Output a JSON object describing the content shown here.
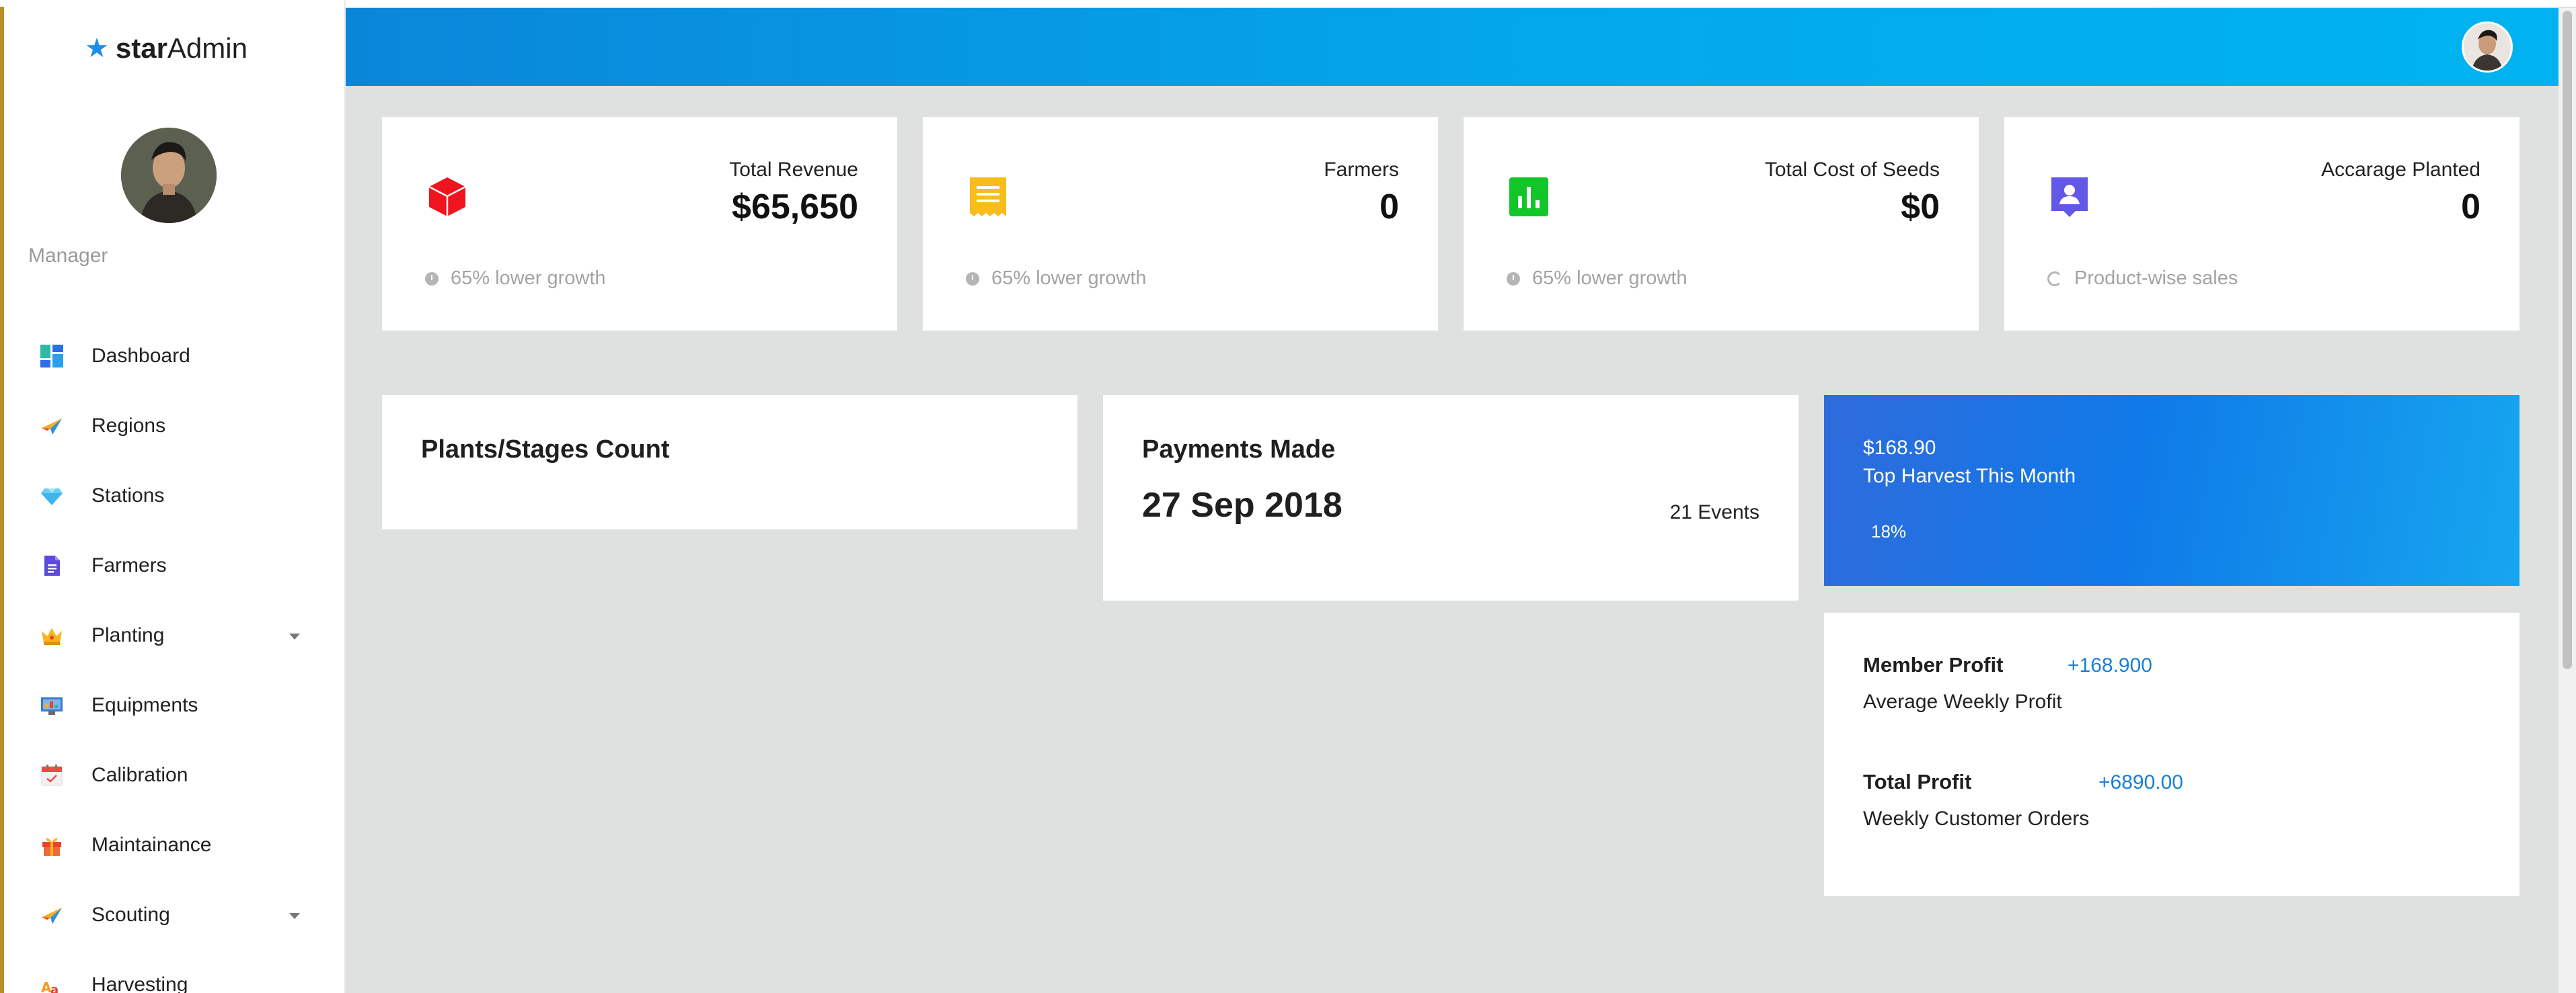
{
  "sidebar": {
    "brand_bold": "star",
    "brand_light": "Admin",
    "role": "Manager",
    "items": [
      {
        "label": "Dashboard",
        "icon": "dashboard-icon",
        "has_caret": false
      },
      {
        "label": "Regions",
        "icon": "paper-plane-icon",
        "has_caret": false
      },
      {
        "label": "Stations",
        "icon": "diamond-icon",
        "has_caret": false
      },
      {
        "label": "Farmers",
        "icon": "document-icon",
        "has_caret": false
      },
      {
        "label": "Planting",
        "icon": "crown-icon",
        "has_caret": true
      },
      {
        "label": "Equipments",
        "icon": "monitor-icon",
        "has_caret": false
      },
      {
        "label": "Calibration",
        "icon": "calendar-icon",
        "has_caret": false
      },
      {
        "label": "Maintainance",
        "icon": "gift-icon",
        "has_caret": false
      },
      {
        "label": "Scouting",
        "icon": "paper-plane-icon",
        "has_caret": true
      },
      {
        "label": "Harvesting",
        "icon": "text-icon",
        "has_caret": false
      }
    ]
  },
  "stats": [
    {
      "title": "Total Revenue",
      "value": "$65,650",
      "footer": "65% lower growth",
      "icon": "cube-icon",
      "color": "#f0141e"
    },
    {
      "title": "Farmers",
      "value": "0",
      "footer": "65% lower growth",
      "icon": "receipt-icon",
      "color": "#f8bd1b"
    },
    {
      "title": "Total Cost of Seeds",
      "value": "$0",
      "footer": "65% lower growth",
      "icon": "bar-chart-icon",
      "color": "#12c629"
    },
    {
      "title": "Accarage Planted",
      "value": "0",
      "footer": "Product-wise sales",
      "icon": "account-box-icon",
      "color": "#6357e6"
    }
  ],
  "plants": {
    "title": "Plants/Stages Count"
  },
  "payments": {
    "title": "Payments Made",
    "date": "27 Sep 2018",
    "events": "21 Events"
  },
  "harvest": {
    "amount": "$168.90",
    "label": "Top Harvest This Month",
    "percent": "18%"
  },
  "profit": {
    "member_label": "Member Profit",
    "member_value": "+168.900",
    "member_sub": "Average Weekly Profit",
    "total_label": "Total Profit",
    "total_value": "+6890.00",
    "total_sub": "Weekly Customer Orders"
  },
  "colors": {
    "accent": "#0a86d9",
    "link": "#1a7fd6"
  }
}
